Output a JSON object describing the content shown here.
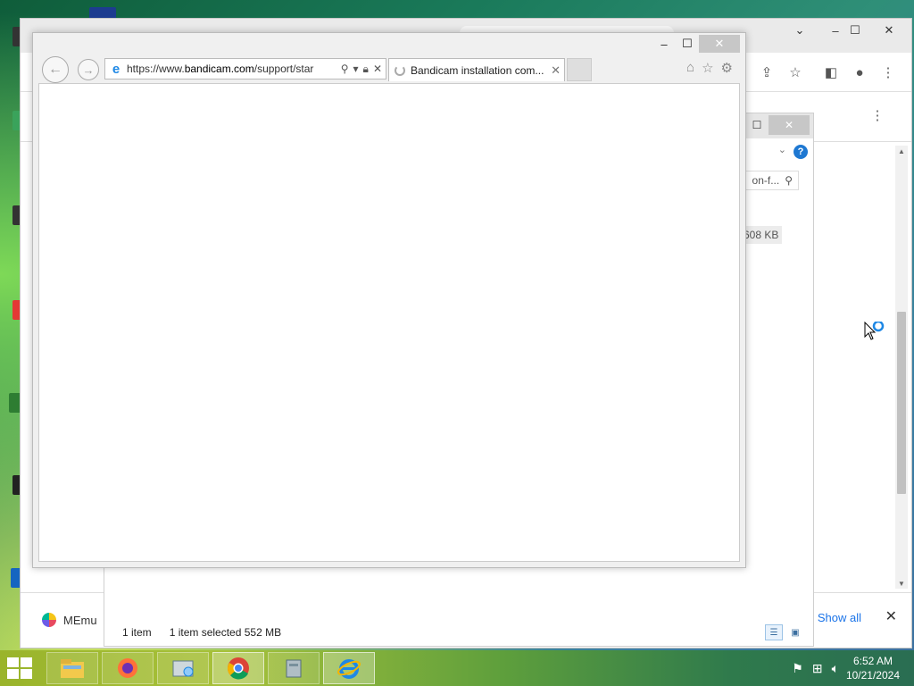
{
  "ie": {
    "address_url_prefix": "https://www.",
    "address_url_domain": "bandicam.com",
    "address_url_path": "/support/star",
    "tab_title": "Bandicam installation com...",
    "minimize": "–",
    "maximize": "☐",
    "close": "✕"
  },
  "explorer": {
    "search_text": "on-f...",
    "file_size": "608 KB",
    "status_count": "1 item",
    "status_selected": "1 item selected  552 MB",
    "help": "?"
  },
  "chrome": {
    "download_item": "MEmu",
    "show_all": "Show all",
    "close_download_bar": "✕"
  },
  "taskbar": {
    "time": "6:52 AM",
    "date": "10/21/2024",
    "pinned": [
      "file-explorer",
      "firefox",
      "control-panel",
      "chrome",
      "install-tool",
      "internet-explorer"
    ]
  },
  "colors": {
    "taskbar_start": "#9ab42b",
    "taskbar_end": "#2a6d52",
    "link_blue": "#1a73e8",
    "ie_blue": "#1e88e5"
  }
}
